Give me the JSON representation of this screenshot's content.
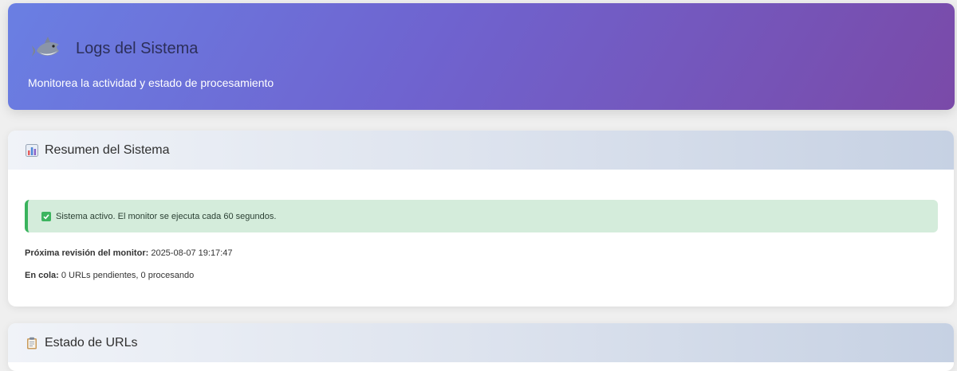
{
  "header": {
    "logo_icon": "shark-icon",
    "title": "Logs del Sistema",
    "subtitle": "Monitorea la actividad y estado de procesamiento"
  },
  "summary": {
    "icon": "bar-chart-icon",
    "title": "Resumen del Sistema",
    "status_icon": "check-box-icon",
    "status_text": "Sistema activo. El monitor se ejecuta cada 60 segundos.",
    "next_check_label": "Próxima revisión del monitor:",
    "next_check_value": "2025-08-07 19:17:47",
    "queue_label": "En cola:",
    "queue_value": "0 URLs pendientes, 0 procesando"
  },
  "urls": {
    "icon": "clipboard-icon",
    "title": "Estado de URLs"
  },
  "colors": {
    "header_start": "#6a7fe3",
    "header_end": "#7a4aa8",
    "success": "#39b35c",
    "success_bg": "#d4ecdb"
  }
}
